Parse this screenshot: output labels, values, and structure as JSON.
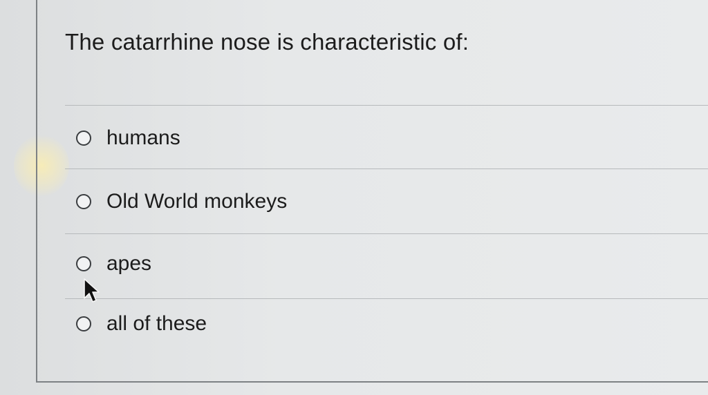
{
  "question": {
    "text": "The catarrhine nose is characteristic of:"
  },
  "options": [
    {
      "label": "humans",
      "selected": false
    },
    {
      "label": "Old World monkeys",
      "selected": false
    },
    {
      "label": "apes",
      "selected": false
    },
    {
      "label": "all of these",
      "selected": false
    }
  ],
  "icons": {
    "radio": "radio-unchecked-icon",
    "pointer": "mouse-pointer-icon"
  },
  "colors": {
    "text": "#1c1c1c",
    "background": "#e4e6e7",
    "divider": "#b6b9bb"
  }
}
